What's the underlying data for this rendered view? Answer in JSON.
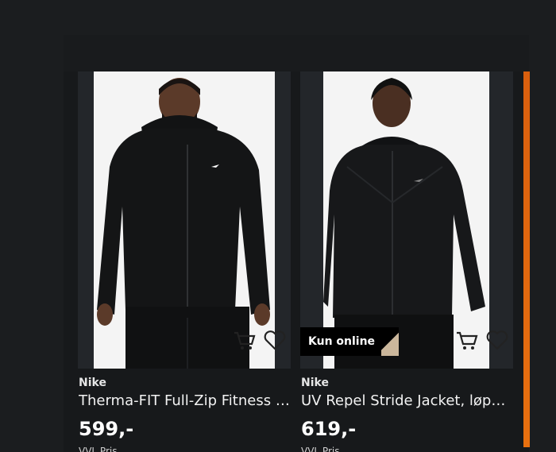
{
  "colors": {
    "background": "#1b1d1f",
    "accent": "#a8e23b",
    "scroll_accent": "#e36a0f",
    "badge_bg": "#000000"
  },
  "products": [
    {
      "brand": "Nike",
      "title": "Therma-FIT Full-Zip Fitness To...",
      "price": "599,-",
      "price_note": "VVL Pris",
      "badge": "",
      "cart_icon": "cart-icon",
      "wishlist_icon": "heart-icon"
    },
    {
      "brand": "Nike",
      "title": "UV Repel Stride Jacket, løpeja...",
      "price": "619,-",
      "price_note": "VVL Pris",
      "badge": "Kun online",
      "cart_icon": "cart-icon",
      "wishlist_icon": "heart-icon"
    }
  ]
}
